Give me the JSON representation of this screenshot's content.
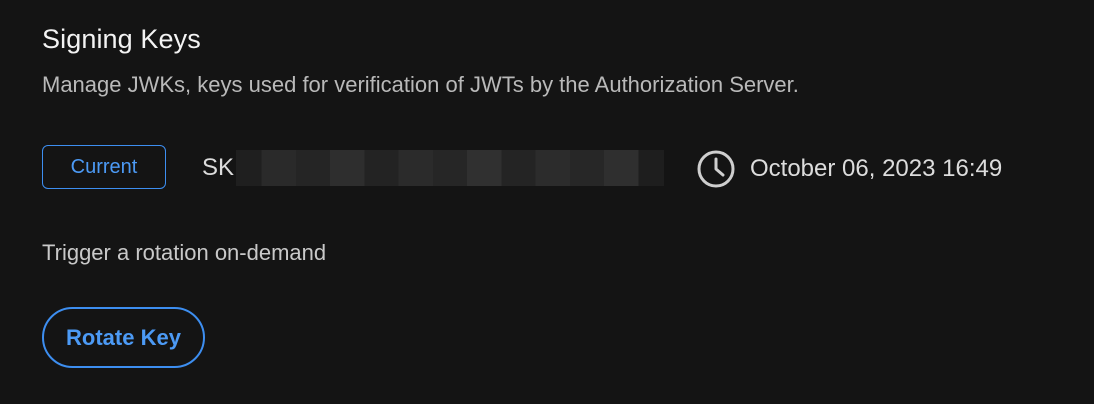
{
  "signing_keys": {
    "title": "Signing Keys",
    "description": "Manage JWKs, keys used for verification of JWTs by the Authorization Server."
  },
  "current_key": {
    "badge": "Current",
    "key_prefix": "SK",
    "created_at": "October 06, 2023 16:49"
  },
  "rotation": {
    "heading": "Trigger a rotation on-demand",
    "button_label": "Rotate Key"
  },
  "icons": {
    "timestamp": "clock-icon"
  },
  "colors": {
    "accent": "#3d8ef0",
    "background": "#141414"
  }
}
